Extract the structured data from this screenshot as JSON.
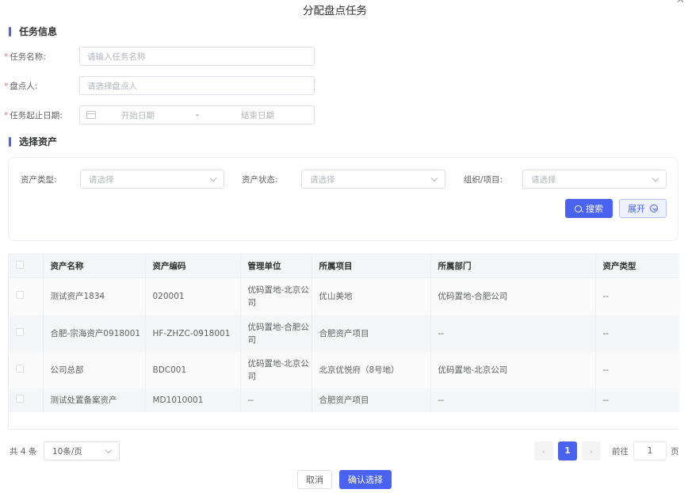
{
  "dialog": {
    "title": "分配盘点任务",
    "close_icon": "close-icon"
  },
  "task_info": {
    "section_title": "任务信息",
    "name_label": "任务名称:",
    "name_placeholder": "请输入任务名称",
    "checker_label": "盘点人:",
    "checker_placeholder": "请选择盘点人",
    "date_label": "任务起止日期:",
    "start_placeholder": "开始日期",
    "separator": "-",
    "end_placeholder": "结束日期",
    "required_mark": "*"
  },
  "asset_select": {
    "section_title": "选择资产",
    "filters": [
      {
        "label": "资产类型:",
        "placeholder": "请选择"
      },
      {
        "label": "资产状态:",
        "placeholder": "请选择"
      },
      {
        "label": "组织/项目:",
        "placeholder": "请选择"
      }
    ],
    "search_label": "搜索",
    "expand_label": "展开"
  },
  "table": {
    "columns": [
      "资产名称",
      "资产编码",
      "管理单位",
      "所属项目",
      "所属部门",
      "资产类型"
    ],
    "rows": [
      [
        "测试资产1834",
        "020001",
        "优码置地-北京公司",
        "优山美地",
        "优码置地-合肥公司",
        "--"
      ],
      [
        "合肥-宗海资产0918001",
        "HF-ZHZC-0918001",
        "优码置地-合肥公司",
        "合肥资产项目",
        "--",
        "--"
      ],
      [
        "公司总部",
        "BDC001",
        "优码置地-北京公司",
        "北京优悦府（8号地）",
        "优码置地-北京公司",
        "--"
      ],
      [
        "测试处置备案资产",
        "MD1010001",
        "--",
        "合肥资产项目",
        "--",
        "--"
      ]
    ]
  },
  "pagination": {
    "total_text": "共 4 条",
    "page_size": "10条/页",
    "current_page": "1",
    "prev_icon": "‹",
    "next_icon": "›",
    "goto_label": "前往",
    "goto_value": "1",
    "page_unit": "页"
  },
  "footer": {
    "cancel_label": "取消",
    "confirm_label": "确认选择"
  },
  "colors": {
    "primary": "#4a62f0",
    "required": "#f56c6c"
  }
}
